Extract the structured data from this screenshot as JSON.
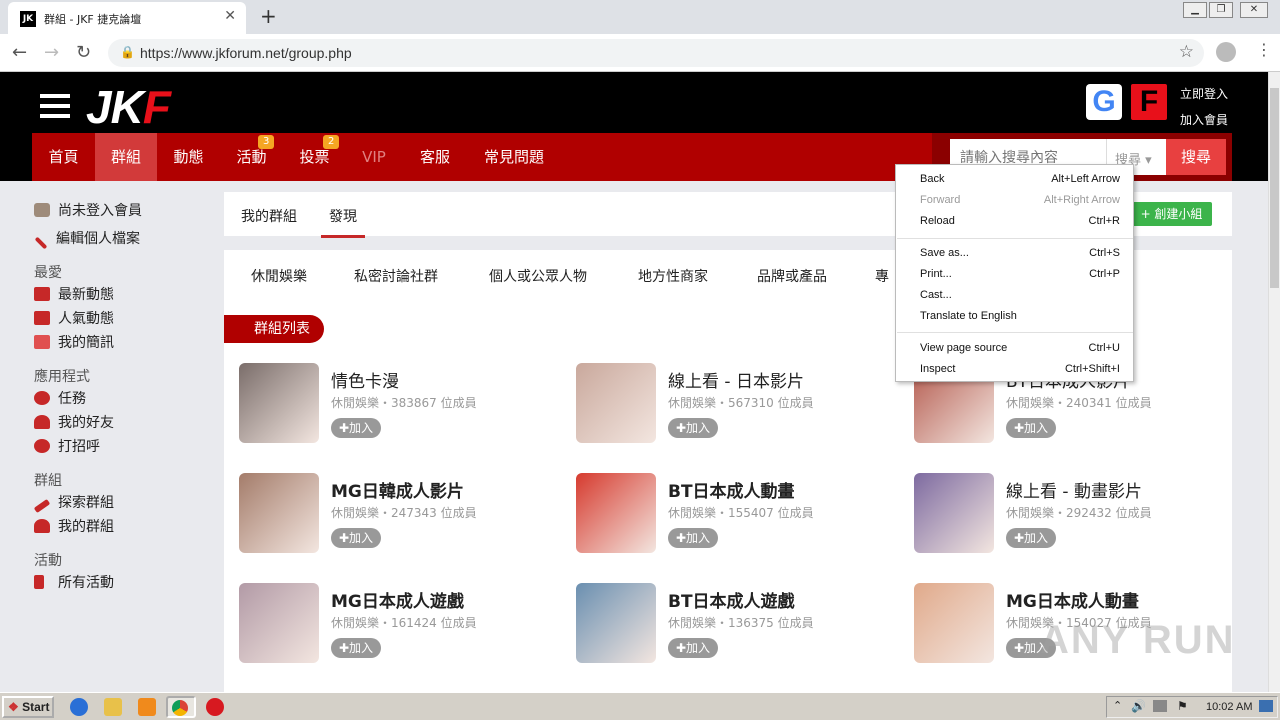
{
  "browser": {
    "tab_title": "群組 - JKF 捷克論壇",
    "favicon_text": "JK",
    "url": "https://www.jkforum.net/group.php"
  },
  "site": {
    "logo_main": "JK",
    "logo_accent": "F",
    "google_letter": "G",
    "fb_letter": "F",
    "login": "立即登入",
    "register": "加入會員",
    "nav": [
      {
        "label": "首頁"
      },
      {
        "label": "群組"
      },
      {
        "label": "動態"
      },
      {
        "label": "活動",
        "badge": "3"
      },
      {
        "label": "投票",
        "badge": "2"
      },
      {
        "label": "VIP"
      },
      {
        "label": "客服"
      },
      {
        "label": "常見問題"
      }
    ],
    "search": {
      "placeholder": "請輸入搜尋內容",
      "type": "搜尋",
      "button": "搜尋"
    }
  },
  "sidebar": {
    "user": "尚未登入會員",
    "edit_profile": "編輯個人檔案",
    "sections": [
      {
        "heading": "最愛",
        "items": [
          "最新動態",
          "人氣動態",
          "我的簡訊"
        ]
      },
      {
        "heading": "應用程式",
        "items": [
          "任務",
          "我的好友",
          "打招呼"
        ]
      },
      {
        "heading": "群組",
        "items": [
          "探索群組",
          "我的群組"
        ]
      },
      {
        "heading": "活動",
        "items": [
          "所有活動"
        ]
      }
    ]
  },
  "main": {
    "tabs": [
      "我的群組",
      "發現"
    ],
    "create_group": "+ 創建小組",
    "categories": [
      "休閒娛樂",
      "私密討論社群",
      "個人或公眾人物",
      "地方性商家",
      "品牌或產品",
      "專"
    ],
    "group_list_label": "群組列表",
    "join_label": "加入",
    "groups": [
      {
        "name": "情色卡漫",
        "meta": "休閒娛樂・383867 位成員",
        "color": "#7a6d6a"
      },
      {
        "name": "線上看 - 日本影片",
        "meta": "休閒娛樂・567310 位成員",
        "color": "#c9a89c"
      },
      {
        "name": "BT日本成人影片",
        "meta": "休閒娛樂・240341 位成員",
        "color": "#b45a4e"
      },
      {
        "name": "MG日韓成人影片",
        "meta": "休閒娛樂・247343 位成員",
        "color": "#a47c6a"
      },
      {
        "name": "BT日本成人動畫",
        "meta": "休閒娛樂・155407 位成員",
        "color": "#d63a2e"
      },
      {
        "name": "線上看 - 動畫影片",
        "meta": "休閒娛樂・292432 位成員",
        "color": "#7d6aa0"
      },
      {
        "name": "MG日本成人遊戲",
        "meta": "休閒娛樂・161424 位成員",
        "color": "#b29aa6"
      },
      {
        "name": "BT日本成人遊戲",
        "meta": "休閒娛樂・136375 位成員",
        "color": "#6a8fb0"
      },
      {
        "name": "MG日本成人動畫",
        "meta": "休閒娛樂・154027 位成員",
        "color": "#e0a98a"
      }
    ]
  },
  "context_menu": {
    "items": [
      {
        "label": "Back",
        "shortcut": "Alt+Left Arrow",
        "disabled": false
      },
      {
        "label": "Forward",
        "shortcut": "Alt+Right Arrow",
        "disabled": true
      },
      {
        "label": "Reload",
        "shortcut": "Ctrl+R",
        "disabled": false
      },
      {
        "label": "Save as...",
        "shortcut": "Ctrl+S",
        "disabled": false
      },
      {
        "label": "Print...",
        "shortcut": "Ctrl+P",
        "disabled": false
      },
      {
        "label": "Cast...",
        "shortcut": "",
        "disabled": false
      },
      {
        "label": "Translate to English",
        "shortcut": "",
        "disabled": false
      },
      {
        "label": "View page source",
        "shortcut": "Ctrl+U",
        "disabled": false
      },
      {
        "label": "Inspect",
        "shortcut": "Ctrl+Shift+I",
        "disabled": false
      }
    ]
  },
  "taskbar": {
    "start": "Start",
    "clock": "10:02 AM"
  },
  "watermark": "ANY RUN"
}
